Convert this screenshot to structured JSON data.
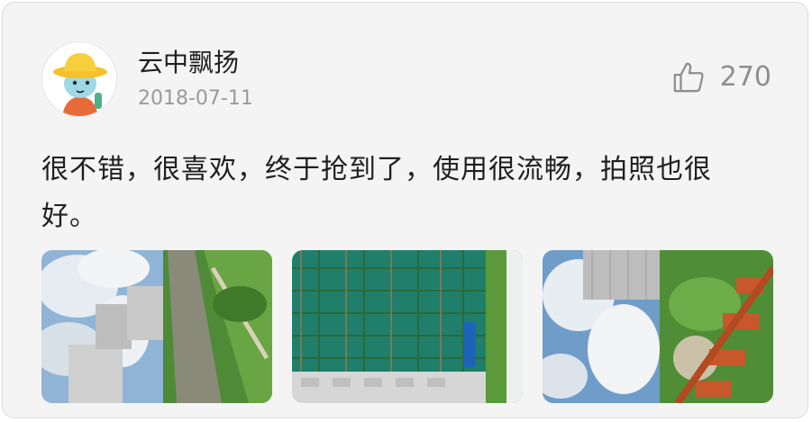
{
  "post": {
    "username": "云中飘扬",
    "date": "2018-07-11",
    "like_count": "270",
    "comment": "很不错，很喜欢，终于抢到了，使用很流畅，拍照也很好。"
  },
  "icons": {
    "avatar": "cartoon-user-avatar-icon",
    "like": "thumbs-up-icon"
  },
  "photos": [
    {
      "name": "photo-1"
    },
    {
      "name": "photo-2"
    },
    {
      "name": "photo-3"
    }
  ],
  "colors": {
    "card_background": "#f4f4f4",
    "text_primary": "#1f1f1f",
    "text_secondary": "#9a9a9a"
  }
}
